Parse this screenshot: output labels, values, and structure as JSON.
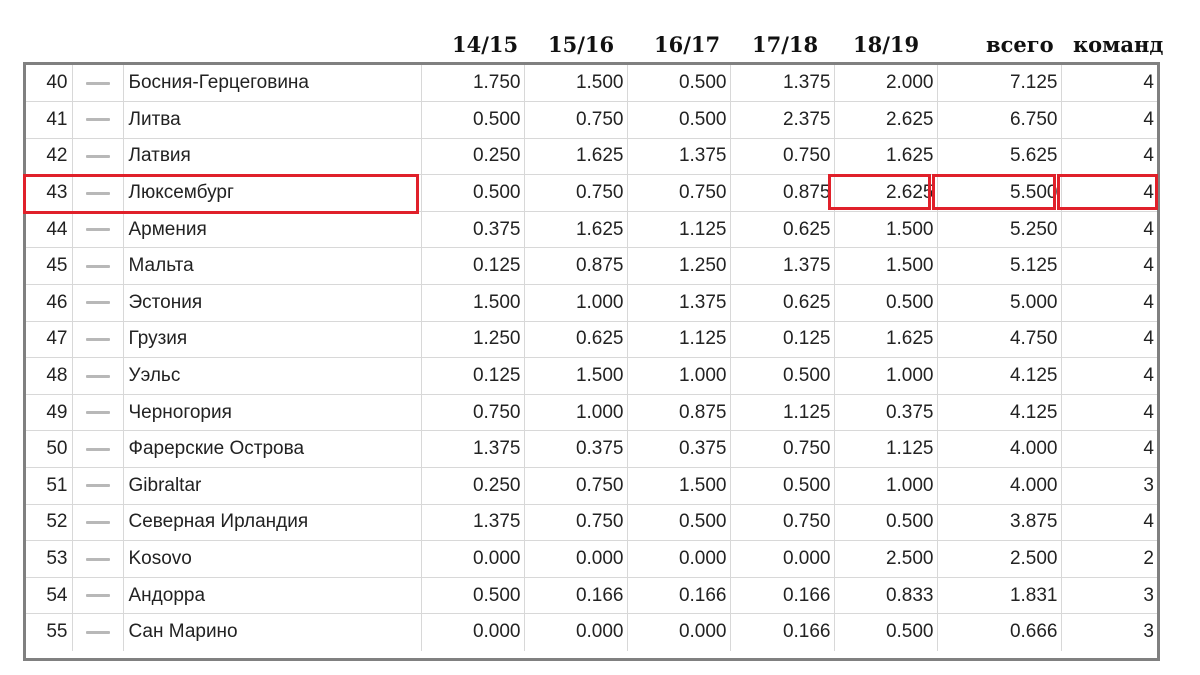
{
  "header": {
    "columns": [
      "14/15",
      "15/16",
      "16/17",
      "17/18",
      "18/19",
      "всего",
      "команд"
    ]
  },
  "rows": [
    {
      "rank": "40",
      "country": "Босния-Герцеговина",
      "s1": "1.750",
      "s2": "1.500",
      "s3": "0.500",
      "s4": "1.375",
      "s5": "2.000",
      "total": "7.125",
      "teams": "4"
    },
    {
      "rank": "41",
      "country": "Литва",
      "s1": "0.500",
      "s2": "0.750",
      "s3": "0.500",
      "s4": "2.375",
      "s5": "2.625",
      "total": "6.750",
      "teams": "4"
    },
    {
      "rank": "42",
      "country": "Латвия",
      "s1": "0.250",
      "s2": "1.625",
      "s3": "1.375",
      "s4": "0.750",
      "s5": "1.625",
      "total": "5.625",
      "teams": "4"
    },
    {
      "rank": "43",
      "country": "Люксембург",
      "s1": "0.500",
      "s2": "0.750",
      "s3": "0.750",
      "s4": "0.875",
      "s5": "2.625",
      "total": "5.500",
      "teams": "4"
    },
    {
      "rank": "44",
      "country": "Армения",
      "s1": "0.375",
      "s2": "1.625",
      "s3": "1.125",
      "s4": "0.625",
      "s5": "1.500",
      "total": "5.250",
      "teams": "4"
    },
    {
      "rank": "45",
      "country": "Мальта",
      "s1": "0.125",
      "s2": "0.875",
      "s3": "1.250",
      "s4": "1.375",
      "s5": "1.500",
      "total": "5.125",
      "teams": "4"
    },
    {
      "rank": "46",
      "country": "Эстония",
      "s1": "1.500",
      "s2": "1.000",
      "s3": "1.375",
      "s4": "0.625",
      "s5": "0.500",
      "total": "5.000",
      "teams": "4"
    },
    {
      "rank": "47",
      "country": "Грузия",
      "s1": "1.250",
      "s2": "0.625",
      "s3": "1.125",
      "s4": "0.125",
      "s5": "1.625",
      "total": "4.750",
      "teams": "4"
    },
    {
      "rank": "48",
      "country": "Уэльс",
      "s1": "0.125",
      "s2": "1.500",
      "s3": "1.000",
      "s4": "0.500",
      "s5": "1.000",
      "total": "4.125",
      "teams": "4"
    },
    {
      "rank": "49",
      "country": "Черногория",
      "s1": "0.750",
      "s2": "1.000",
      "s3": "0.875",
      "s4": "1.125",
      "s5": "0.375",
      "total": "4.125",
      "teams": "4"
    },
    {
      "rank": "50",
      "country": "Фарерские Острова",
      "s1": "1.375",
      "s2": "0.375",
      "s3": "0.375",
      "s4": "0.750",
      "s5": "1.125",
      "total": "4.000",
      "teams": "4"
    },
    {
      "rank": "51",
      "country": "Gibraltar",
      "s1": "0.250",
      "s2": "0.750",
      "s3": "1.500",
      "s4": "0.500",
      "s5": "1.000",
      "total": "4.000",
      "teams": "3"
    },
    {
      "rank": "52",
      "country": "Северная Ирландия",
      "s1": "1.375",
      "s2": "0.750",
      "s3": "0.500",
      "s4": "0.750",
      "s5": "0.500",
      "total": "3.875",
      "teams": "4"
    },
    {
      "rank": "53",
      "country": "Kosovo",
      "s1": "0.000",
      "s2": "0.000",
      "s3": "0.000",
      "s4": "0.000",
      "s5": "2.500",
      "total": "2.500",
      "teams": "2"
    },
    {
      "rank": "54",
      "country": "Андорра",
      "s1": "0.500",
      "s2": "0.166",
      "s3": "0.166",
      "s4": "0.166",
      "s5": "0.833",
      "total": "1.831",
      "teams": "3"
    },
    {
      "rank": "55",
      "country": "Сан Марино",
      "s1": "0.000",
      "s2": "0.000",
      "s3": "0.000",
      "s4": "0.166",
      "s5": "0.500",
      "total": "0.666",
      "teams": "3"
    }
  ],
  "colors": {
    "highlight": "#e0202a",
    "border": "#808080",
    "grid": "#d8d8d8",
    "trend_dash": "#b8b8b8"
  },
  "trend_icon": "dash-icon",
  "highlighted_row_rank": "43"
}
